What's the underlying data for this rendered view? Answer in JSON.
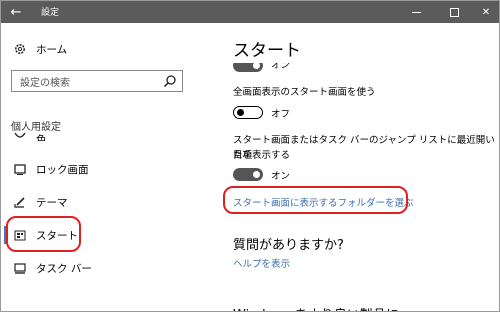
{
  "window": {
    "title": "設定",
    "back_icon": "arrow-left-icon",
    "controls": [
      "minimize",
      "maximize",
      "close"
    ]
  },
  "sidebar": {
    "home_label": "ホーム",
    "search_placeholder": "設定の検索",
    "group_label": "個人用設定",
    "items": [
      {
        "label": "色",
        "icon": "palette-icon"
      },
      {
        "label": "ロック画面",
        "icon": "lock-screen-icon"
      },
      {
        "label": "テーマ",
        "icon": "theme-brush-icon"
      },
      {
        "label": "スタート",
        "icon": "start-icon",
        "selected": true
      },
      {
        "label": "タスク バー",
        "icon": "taskbar-icon"
      }
    ],
    "accent_color": "#3c78c8"
  },
  "main": {
    "title": "スタート",
    "toggle0_state": "オン",
    "setting1_label": "全画面表示のスタート画面を使う",
    "toggle1_state": "オフ",
    "setting2_label_line1": "スタート画面またはタスク バーのジャンプ リストに最近開いた項",
    "setting2_label_line2": "目を表示する",
    "toggle2_state": "オン",
    "folders_link": "スタート画面に表示するフォルダーを選ぶ",
    "question_title": "質問がありますか?",
    "help_link": "ヘルプを表示",
    "windows_heading": "Windows をより良い製品に"
  },
  "highlight_color": "#e02020"
}
